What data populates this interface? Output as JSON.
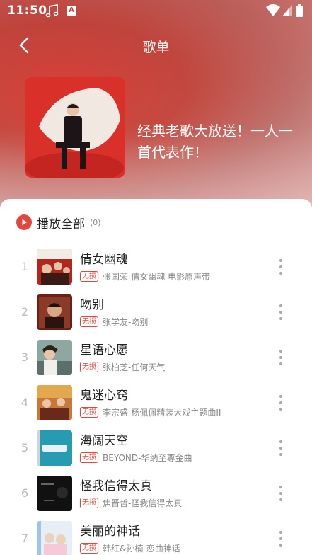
{
  "status_bar": {
    "time": "11:50",
    "icons": [
      "music-note-icon",
      "a-badge-icon",
      "wifi-icon",
      "signal-icon",
      "battery-icon"
    ],
    "a_badge_text": "A"
  },
  "nav": {
    "back_icon": "back-arrow-icon",
    "title": "歌单"
  },
  "playlist": {
    "description": "经典老歌大放送！一人一首代表作！"
  },
  "play_all": {
    "label": "播放全部",
    "count": "(0)",
    "icon": "play-circle-icon"
  },
  "songs": [
    {
      "index": "1",
      "title": "倩女幽魂",
      "badge": "无损",
      "subtitle": "张国荣-倩女幽魂 电影原声带"
    },
    {
      "index": "2",
      "title": "吻别",
      "badge": "无损",
      "subtitle": "张学友-吻别"
    },
    {
      "index": "3",
      "title": "星语心愿",
      "badge": "无损",
      "subtitle": "张柏芝-任何天气"
    },
    {
      "index": "4",
      "title": "鬼迷心窍",
      "badge": "无损",
      "subtitle": "李宗盛-杨佩佩精装大戏主题曲II"
    },
    {
      "index": "5",
      "title": "海阔天空",
      "badge": "无损",
      "subtitle": "BEYOND-华纳至尊金曲"
    },
    {
      "index": "6",
      "title": "怪我信得太真",
      "badge": "无损",
      "subtitle": "焦晋哲-怪我信得太真"
    },
    {
      "index": "7",
      "title": "美丽的神话",
      "badge": "无损",
      "subtitle": "韩红&孙楠-恋曲神话"
    }
  ],
  "colors": {
    "accent": "#e3473c",
    "hero": "#c44a41"
  }
}
